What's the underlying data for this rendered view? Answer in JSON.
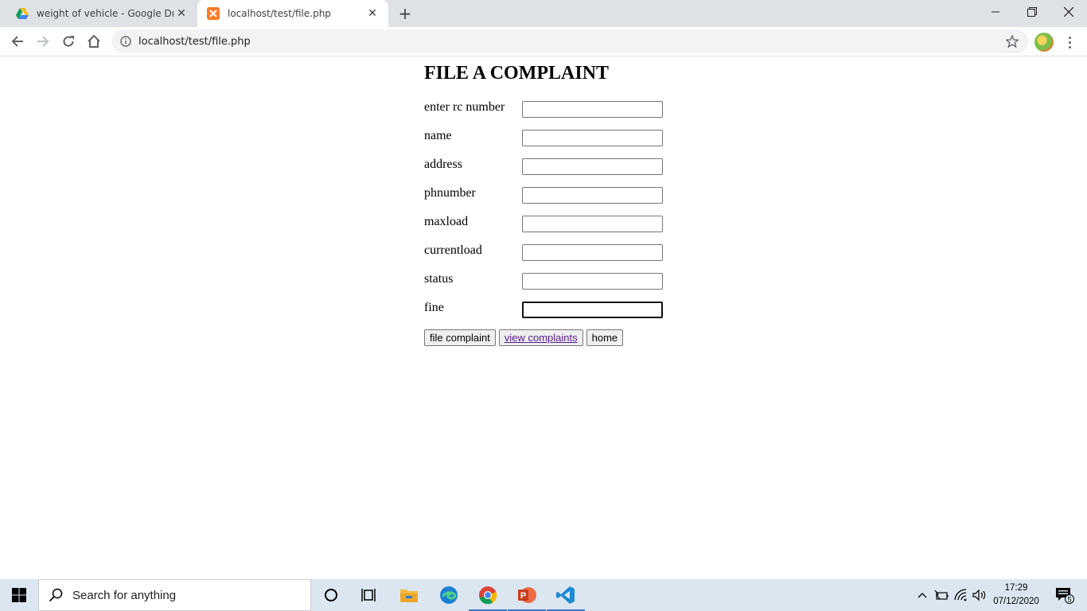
{
  "browser": {
    "tabs": [
      {
        "title": "weight of vehicle - Google Drive",
        "close": "✕",
        "favicon": "google-drive-icon"
      },
      {
        "title": "localhost/test/file.php",
        "close": "✕",
        "favicon": "xampp-icon"
      }
    ],
    "new_tab": "+",
    "url": "localhost/test/file.php"
  },
  "page": {
    "heading": "FILE A COMPLAINT",
    "fields": [
      {
        "label": "enter rc number",
        "value": ""
      },
      {
        "label": "name",
        "value": ""
      },
      {
        "label": "address",
        "value": ""
      },
      {
        "label": "phnumber",
        "value": ""
      },
      {
        "label": "maxload",
        "value": ""
      },
      {
        "label": "currentload",
        "value": ""
      },
      {
        "label": "status",
        "value": ""
      },
      {
        "label": "fine",
        "value": ""
      }
    ],
    "buttons": {
      "file_complaint": "file complaint",
      "view_complaints": "view complaints",
      "home": "home"
    }
  },
  "taskbar": {
    "search_placeholder": "Search for anything",
    "time": "17:29",
    "date": "07/12/2020",
    "notification_count": "5"
  },
  "colors": {
    "tabstrip": "#dee1e6",
    "taskbar": "#dce6f0",
    "visited_link": "#551a8b"
  }
}
